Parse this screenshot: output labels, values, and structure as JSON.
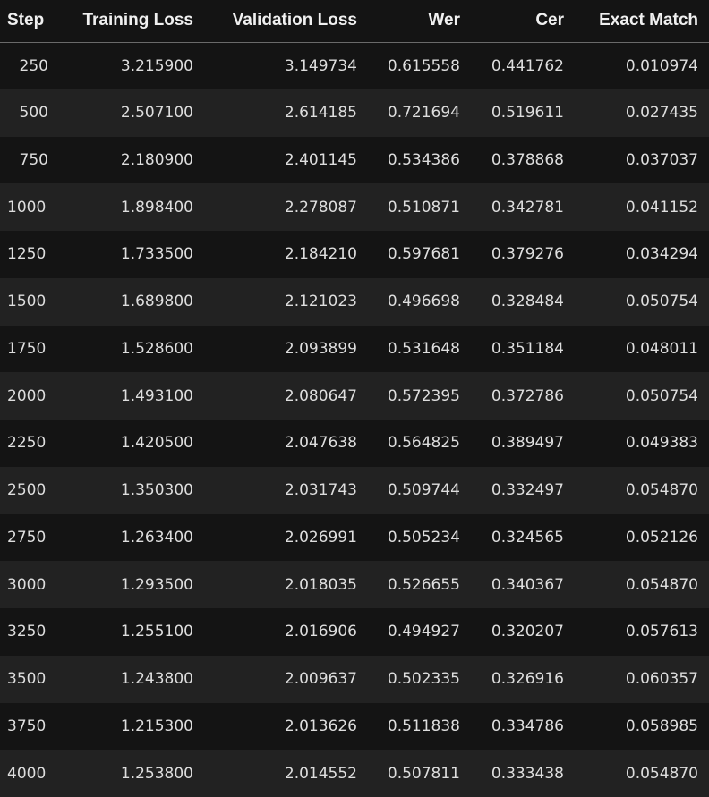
{
  "table": {
    "columns": [
      "Step",
      "Training Loss",
      "Validation Loss",
      "Wer",
      "Cer",
      "Exact Match"
    ],
    "rows": [
      [
        "250",
        "3.215900",
        "3.149734",
        "0.615558",
        "0.441762",
        "0.010974"
      ],
      [
        "500",
        "2.507100",
        "2.614185",
        "0.721694",
        "0.519611",
        "0.027435"
      ],
      [
        "750",
        "2.180900",
        "2.401145",
        "0.534386",
        "0.378868",
        "0.037037"
      ],
      [
        "1000",
        "1.898400",
        "2.278087",
        "0.510871",
        "0.342781",
        "0.041152"
      ],
      [
        "1250",
        "1.733500",
        "2.184210",
        "0.597681",
        "0.379276",
        "0.034294"
      ],
      [
        "1500",
        "1.689800",
        "2.121023",
        "0.496698",
        "0.328484",
        "0.050754"
      ],
      [
        "1750",
        "1.528600",
        "2.093899",
        "0.531648",
        "0.351184",
        "0.048011"
      ],
      [
        "2000",
        "1.493100",
        "2.080647",
        "0.572395",
        "0.372786",
        "0.050754"
      ],
      [
        "2250",
        "1.420500",
        "2.047638",
        "0.564825",
        "0.389497",
        "0.049383"
      ],
      [
        "2500",
        "1.350300",
        "2.031743",
        "0.509744",
        "0.332497",
        "0.054870"
      ],
      [
        "2750",
        "1.263400",
        "2.026991",
        "0.505234",
        "0.324565",
        "0.052126"
      ],
      [
        "3000",
        "1.293500",
        "2.018035",
        "0.526655",
        "0.340367",
        "0.054870"
      ],
      [
        "3250",
        "1.255100",
        "2.016906",
        "0.494927",
        "0.320207",
        "0.057613"
      ],
      [
        "3500",
        "1.243800",
        "2.009637",
        "0.502335",
        "0.326916",
        "0.060357"
      ],
      [
        "3750",
        "1.215300",
        "2.013626",
        "0.511838",
        "0.334786",
        "0.058985"
      ],
      [
        "4000",
        "1.253800",
        "2.014552",
        "0.507811",
        "0.333438",
        "0.054870"
      ]
    ]
  }
}
